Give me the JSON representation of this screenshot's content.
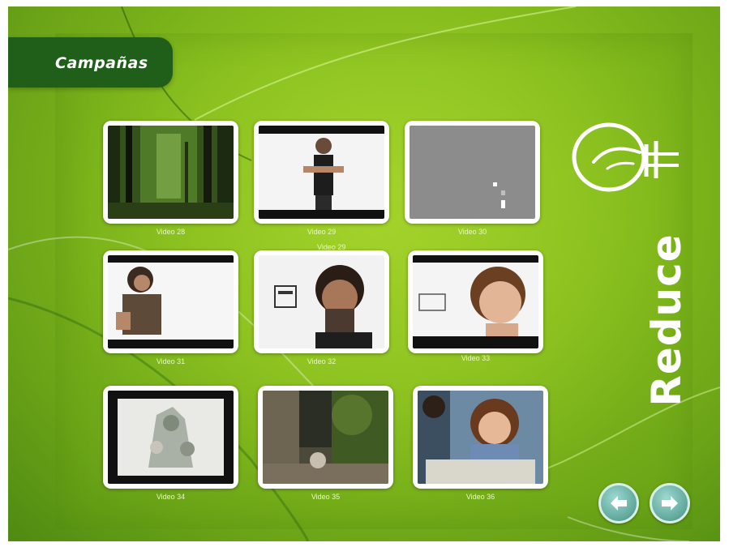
{
  "header": {
    "title": "Campañas"
  },
  "side": {
    "vertical_title": "Reduce",
    "logo_icon": "lightbulb-leaf-icon"
  },
  "videos": [
    {
      "label": "Video 28",
      "scene": "forest"
    },
    {
      "label": "Video 29",
      "scene": "sign-language"
    },
    {
      "label": "Video 30",
      "scene": "gray-blank"
    },
    {
      "label": "Video 31",
      "scene": "woman-speaking"
    },
    {
      "label": "Video 32",
      "scene": "bearded-man"
    },
    {
      "label": "Video 33",
      "scene": "boy"
    },
    {
      "label": "Video 34",
      "scene": "collage"
    },
    {
      "label": "Video 35",
      "scene": "doorway"
    },
    {
      "label": "Video 36",
      "scene": "girl-eating"
    }
  ],
  "extra_caption": "Video 29",
  "nav": {
    "prev_icon": "arrow-left-icon",
    "next_icon": "arrow-right-icon"
  },
  "colors": {
    "background": "#86bd1d",
    "title_tab": "#1f5f1a",
    "nav_button": "#5fa79c"
  }
}
